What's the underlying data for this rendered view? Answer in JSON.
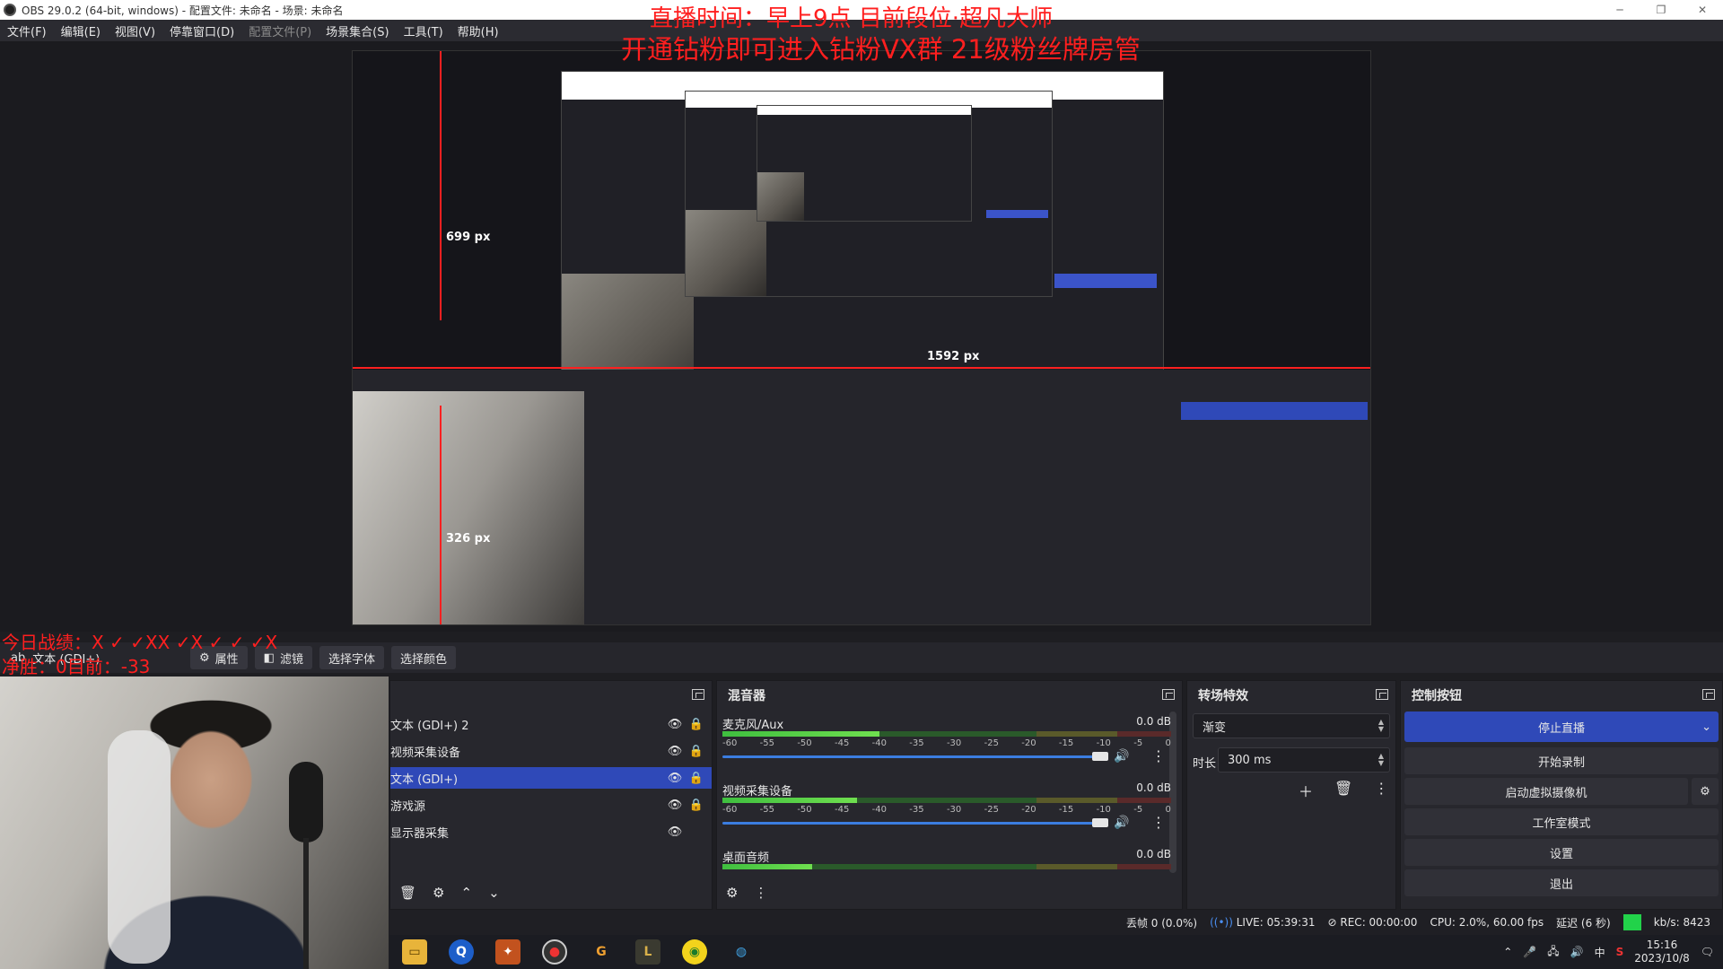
{
  "window": {
    "title": "OBS 29.0.2 (64-bit, windows) - 配置文件: 未命名 - 场景: 未命名"
  },
  "menu": {
    "items": [
      "文件(F)",
      "编辑(E)",
      "视图(V)",
      "停靠窗口(D)",
      "配置文件(P)",
      "场景集合(S)",
      "工具(T)",
      "帮助(H)"
    ],
    "disabled_index": 4
  },
  "overlay": {
    "line1": "直播时间：早上9点  目前段位·超凡大师",
    "line2": "开通钻粉即可进入钻粉VX群  21级粉丝牌房管",
    "score1": "今日战绩：X ✓ ✓XX ✓X ✓ ✓ ✓X",
    "score2": "净胜：0目前：-33"
  },
  "measure": {
    "height_label": "699 px",
    "width_label": "1592 px",
    "cam_label": "326 px"
  },
  "source_toolbar": {
    "source_name": "文本 (GDI+)",
    "props": "属性",
    "filters": "滤镜",
    "font": "选择字体",
    "color": "选择颜色"
  },
  "sources": {
    "items": [
      {
        "label": "文本 (GDI+) 2",
        "selected": false
      },
      {
        "label": "视频采集设备",
        "selected": false
      },
      {
        "label": "文本 (GDI+)",
        "selected": true
      },
      {
        "label": "游戏源",
        "selected": false
      },
      {
        "label": "显示器采集",
        "selected": false
      }
    ]
  },
  "mixer": {
    "title": "混音器",
    "scale": [
      "-60",
      "-55",
      "-50",
      "-45",
      "-40",
      "-35",
      "-30",
      "-25",
      "-20",
      "-15",
      "-10",
      "-5",
      "0"
    ],
    "channels": [
      {
        "name": "麦克风/Aux",
        "db": "0.0 dB",
        "level": 0.35
      },
      {
        "name": "视频采集设备",
        "db": "0.0 dB",
        "level": 0.3
      },
      {
        "name": "桌面音频",
        "db": "0.0 dB",
        "level": 0.2
      }
    ]
  },
  "transitions": {
    "title": "转场特效",
    "selected": "渐变",
    "duration_label": "时长",
    "duration": "300 ms"
  },
  "controls": {
    "title": "控制按钮",
    "stop_stream": "停止直播",
    "start_record": "开始录制",
    "virtual_cam": "启动虚拟摄像机",
    "studio": "工作室模式",
    "settings": "设置",
    "exit": "退出"
  },
  "status": {
    "dropped": "丢帧 0 (0.0%)",
    "live": "LIVE: 05:39:31",
    "rec": "REC: 00:00:00",
    "cpu": "CPU: 2.0%, 60.00 fps",
    "delay": "延迟 (6 秒)",
    "kbps": "kb/s: 8423"
  },
  "tray": {
    "ime": "中",
    "time": "15:16",
    "date": "2023/10/8"
  },
  "colors": {
    "accent": "#2f49b8",
    "overlay_red": "#ff1f1f",
    "status_green": "#22d24a"
  }
}
